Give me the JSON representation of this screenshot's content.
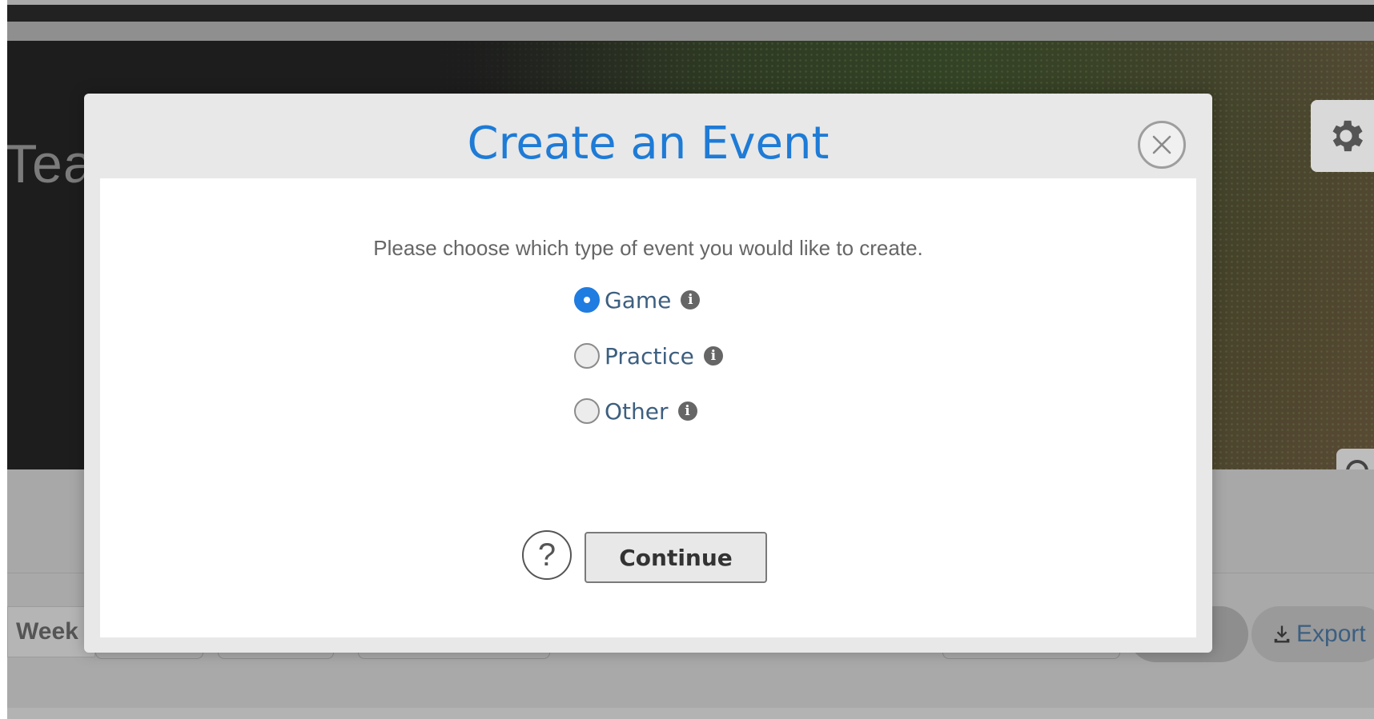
{
  "background": {
    "team_title": "Tea",
    "settings_icon": "gear-icon",
    "camera_icon": "camera-icon",
    "week_label": "Week",
    "export_label": "Export",
    "export_icon": "download-icon"
  },
  "modal": {
    "title": "Create an Event",
    "close_icon": "close-icon",
    "prompt": "Please choose which type of event you would like to create.",
    "options": [
      {
        "label": "Game",
        "checked": true,
        "info_icon": "info-icon"
      },
      {
        "label": "Practice",
        "checked": false,
        "info_icon": "info-icon"
      },
      {
        "label": "Other",
        "checked": false,
        "info_icon": "info-icon"
      }
    ],
    "help_icon": "question-icon",
    "continue_label": "Continue"
  },
  "colors": {
    "title_blue": "#1e7bd6",
    "radio_selected": "#1f7ce0",
    "option_label": "#3d5f7f"
  }
}
